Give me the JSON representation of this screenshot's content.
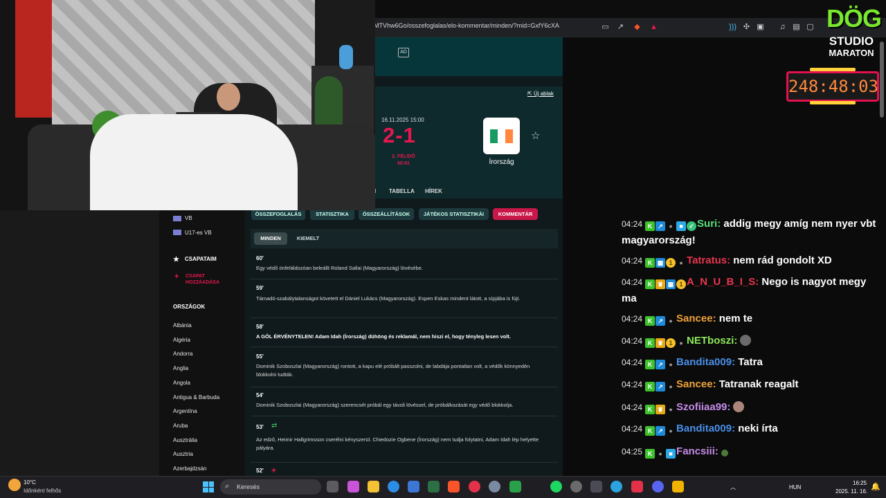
{
  "browser": {
    "url": "MTVhw6Go/osszefoglalas/elo-kommentar/minden/?mid=GxfY6cXA"
  },
  "webpage": {
    "ad_label": "AD",
    "new_window": "Új ablak",
    "match": {
      "date": "16.11.2025 15:00",
      "score": "2-1",
      "period": "2. FÉLIDŐ",
      "clock": "60:01",
      "away_team": "Írország"
    },
    "nav": [
      "I",
      "TABELLA",
      "HÍREK"
    ],
    "tabs": [
      "ÖSSZEFOGLALÁS",
      "STATISZTIKA",
      "ÖSSZEÁLLÍTÁSOK",
      "JÁTÉKOS STATISZTIKÁI",
      "KOMMENTÁR"
    ],
    "active_tab": "KOMMENTÁR",
    "subtabs": [
      "MINDEN",
      "KIEMELT"
    ],
    "events": [
      {
        "minute": "60'",
        "text": "Egy védő önfeláldozóan beleállt Roland Sallai (Magyarország) lövésébe.",
        "bold": false
      },
      {
        "minute": "59'",
        "text": "Támadó-szabálytalanságot követett el Dániel Lukács (Magyarország). Espen Eskas mindent látott, a sípjába is fújt.",
        "bold": false
      },
      {
        "minute": "58'",
        "text": "A GÓL ÉRVÉNYTELEN! Adam Idah (Írország) dühöng és reklamál, nem hiszi el, hogy tényleg lesen volt.",
        "bold": true
      },
      {
        "minute": "55'",
        "text": "Dominik Szoboszlai (Magyarország) rontott, a kapu elé próbált passzolni, de labdája pontatlan volt, a védők könnyedén blokkolni tudták.",
        "bold": false
      },
      {
        "minute": "54'",
        "text": "Dominik Szoboszlai (Magyarország) szerencsét próbál egy távoli lövéssel, de próbálkozását egy védő blokkolja.",
        "bold": false
      },
      {
        "minute": "53'",
        "text": "Az edző, Heimir Hallgrimsson cserélni kényszerül. Chiedozie Ogbene (Írország) nem tudja folytatni, Adam Idah lép helyette pályára.",
        "bold": false
      },
      {
        "minute": "52'",
        "text": "",
        "bold": false
      }
    ],
    "sidebar": {
      "competitions": [
        "VB",
        "U17-es VB"
      ],
      "my_teams_heading": "CSAPATAIM",
      "add_team": "CSAPAT HOZZÁADÁSA",
      "countries_heading": "ORSZÁGOK",
      "countries": [
        "Albánia",
        "Algéria",
        "Andorra",
        "Anglia",
        "Angola",
        "Antigua & Barbuda",
        "Argentína",
        "Aruba",
        "Ausztrália",
        "Ausztria",
        "Azerbajdzsán"
      ]
    }
  },
  "overlay": {
    "logo_line1": "DÖG",
    "logo_line2": "STUDIO",
    "logo_line3": "MARATON",
    "timer": "248:48:03"
  },
  "chat": [
    {
      "time": "04:24",
      "user": "Suri:",
      "color": "#58e07a",
      "msg": "addig megy amíg nem nyer vbt magyarország!"
    },
    {
      "time": "04:24",
      "user": "Tatratus:",
      "color": "#e8364f",
      "msg": "nem rád gondolt XD"
    },
    {
      "time": "04:24",
      "user": "A_N_U_B_I_S:",
      "color": "#e8364f",
      "msg": "Nego is nagyot megy ma"
    },
    {
      "time": "04:24",
      "user": "Sancee:",
      "color": "#f0a23a",
      "msg": "nem te"
    },
    {
      "time": "04:24",
      "user": "NETboszi:",
      "color": "#8ee85a",
      "msg": ""
    },
    {
      "time": "04:24",
      "user": "Bandita009:",
      "color": "#4a8fe8",
      "msg": "Tatra"
    },
    {
      "time": "04:24",
      "user": "Sancee:",
      "color": "#f0a23a",
      "msg": "Tatranak reagalt"
    },
    {
      "time": "04:24",
      "user": "Szofiiaa99:",
      "color": "#c58be8",
      "msg": ""
    },
    {
      "time": "04:24",
      "user": "Bandita009:",
      "color": "#4a8fe8",
      "msg": "neki írta"
    },
    {
      "time": "04:25",
      "user": "Fancsiii:",
      "color": "#c58be8",
      "msg": ""
    }
  ],
  "taskbar": {
    "temp": "10°C",
    "weather": "Időnként felhős",
    "search": "Keresés",
    "lang": "HUN",
    "time": "16:25",
    "date": "2025. 11. 16."
  }
}
